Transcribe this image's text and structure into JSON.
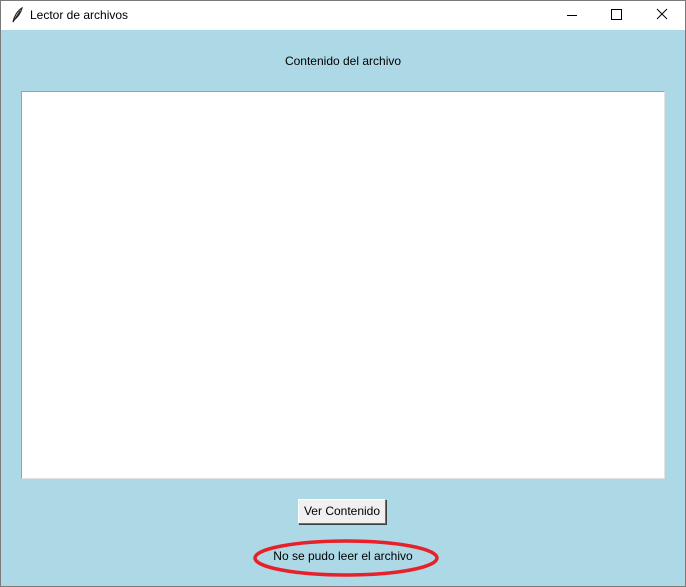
{
  "window": {
    "title": "Lector de archivos",
    "app_icon": "feather-icon",
    "controls": {
      "minimize": "minimize-icon",
      "maximize": "maximize-icon",
      "close": "close-icon"
    }
  },
  "main": {
    "content_label": "Contenido del archivo",
    "text_area_value": "",
    "ver_button_label": "Ver Contenido",
    "status_message": "No se pudo leer el archivo"
  },
  "colors": {
    "background": "#add8e6",
    "highlight_ellipse": "#e8202a"
  }
}
